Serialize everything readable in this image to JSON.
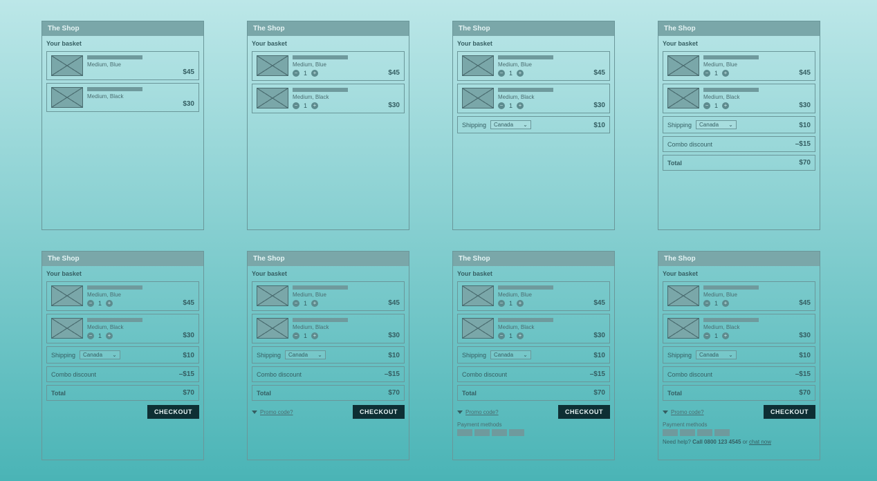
{
  "shop_title": "The Shop",
  "section": "Your basket",
  "items": [
    {
      "variant": "Medium, Blue",
      "qty": 1,
      "price": "$45"
    },
    {
      "variant": "Medium, Black",
      "qty": 1,
      "price": "$30"
    }
  ],
  "shipping": {
    "label": "Shipping",
    "country": "Canada",
    "price": "$10"
  },
  "discount": {
    "label": "Combo discount",
    "price": "–$15"
  },
  "total": {
    "label": "Total",
    "price": "$70"
  },
  "checkout_label": "CHECKOUT",
  "promo_label": "Promo code?",
  "payment_label": "Payment methods",
  "help_prefix": "Need help? ",
  "help_call": "Call 0800 123 4545",
  "help_or": " or ",
  "help_chat": "chat now"
}
